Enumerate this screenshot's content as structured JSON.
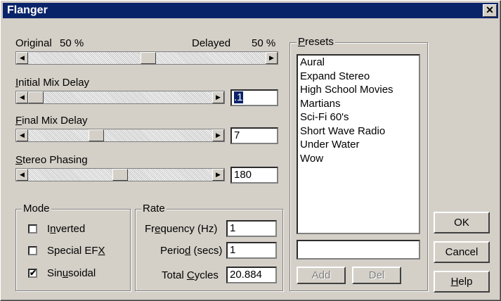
{
  "window": {
    "title": "Flanger",
    "close_glyph": "✕"
  },
  "mix": {
    "original_label": "Original",
    "original_value": "50 %",
    "delayed_label": "Delayed",
    "delayed_value": "50 %",
    "slider_level": 0.5
  },
  "initial_mix_delay": {
    "label_u": "I",
    "label_rest": "nitial Mix Delay",
    "value": ".1",
    "slider_level": 0.0
  },
  "final_mix_delay": {
    "label_u": "F",
    "label_rest": "inal Mix Delay",
    "value": "7",
    "slider_level": 0.35
  },
  "stereo_phasing": {
    "label_u": "S",
    "label_rest": "tereo Phasing",
    "value": "180",
    "slider_level": 0.5
  },
  "mode": {
    "title": "Mode",
    "inverted": {
      "pre": "I",
      "u": "n",
      "post": "verted",
      "checked": false
    },
    "special_efx": {
      "pre": "Special EF",
      "u": "X",
      "post": "",
      "checked": false
    },
    "sinusoidal": {
      "pre": "Sin",
      "u": "u",
      "post": "soidal",
      "checked": true
    }
  },
  "rate": {
    "title": "Rate",
    "frequency": {
      "pre": "Fr",
      "u": "e",
      "post": "quency (Hz)",
      "value": "1"
    },
    "period": {
      "pre": "Perio",
      "u": "d",
      "post": " (secs)",
      "value": "1"
    },
    "total_cycles": {
      "pre": "Total ",
      "u": "C",
      "post": "ycles",
      "value": "20.884"
    }
  },
  "presets": {
    "title_u": "P",
    "title_rest": "resets",
    "items": [
      "Aural",
      "Expand Stereo",
      "High School Movies",
      "Martians",
      "Sci-Fi 60's",
      "Short Wave Radio",
      "Under Water",
      "Wow"
    ],
    "name_value": "",
    "add_label": "Add",
    "del_label": "Del"
  },
  "buttons": {
    "ok": "OK",
    "cancel": "Cancel",
    "help_u": "H",
    "help_rest": "elp"
  }
}
